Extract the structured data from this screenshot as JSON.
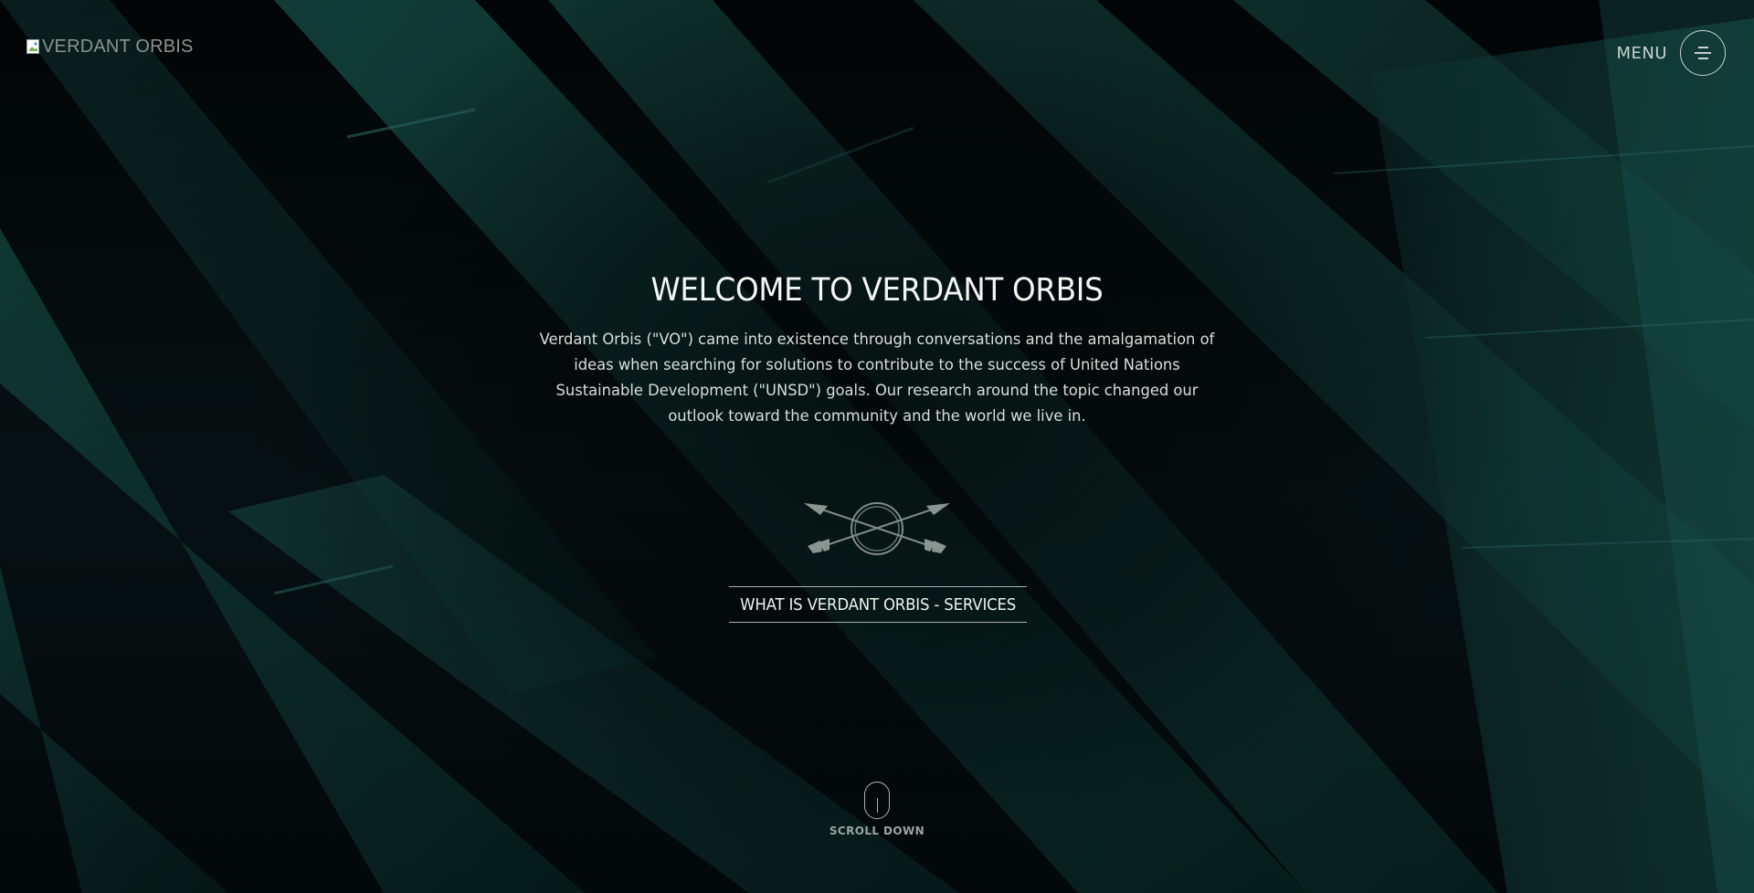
{
  "header": {
    "logo_alt": "VERDANT ORBIS",
    "menu_label": "MENU"
  },
  "hero": {
    "title": "WELCOME TO VERDANT ORBIS",
    "description": "Verdant Orbis (\"VO\") came into existence through conversations and the amalgamation of ideas when searching for solutions to contribute to the success of United Nations Sustainable Development (\"UNSD\") goals. Our research around the topic changed our outlook toward the community and the world we live in.",
    "emblem_icon": "arrows-circle-emblem-icon",
    "services_link": "WHAT IS VERDANT ORBIS - SERVICES"
  },
  "scroll": {
    "label": "SCROLL DOWN",
    "icon": "mouse-icon"
  },
  "colors": {
    "background": "#05090a",
    "stripe": "#0f3a35",
    "text": "#eef2f0",
    "muted": "#9aa4a1"
  }
}
